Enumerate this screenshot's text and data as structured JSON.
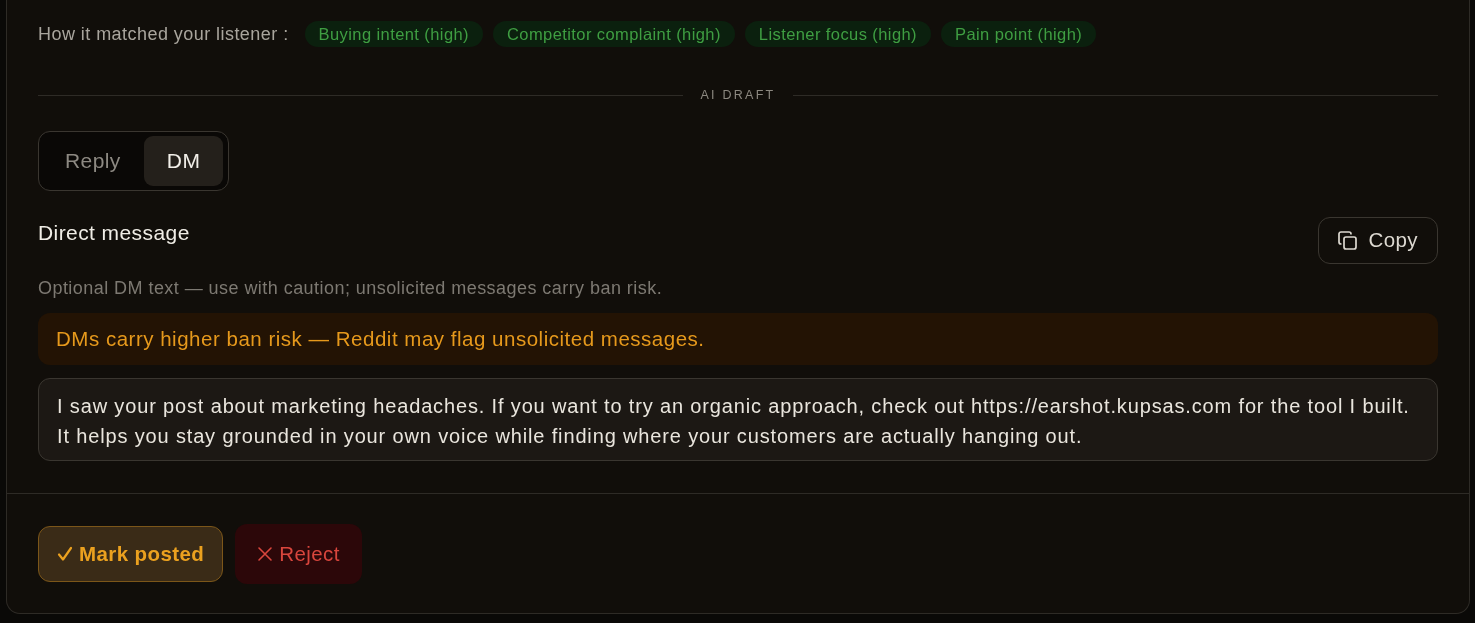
{
  "match": {
    "label": "How it matched your listener :",
    "tags": [
      "Buying intent (high)",
      "Competitor complaint (high)",
      "Listener focus (high)",
      "Pain point (high)"
    ]
  },
  "divider": {
    "label": "AI DRAFT"
  },
  "mode_tabs": [
    {
      "label": "Reply",
      "selected": false
    },
    {
      "label": "DM",
      "selected": true
    }
  ],
  "section": {
    "title": "Direct message",
    "copy_button": "Copy",
    "hint": "Optional DM text — use with caution; unsolicited messages carry ban risk.",
    "warning": "DMs carry higher ban risk — Reddit may flag unsolicited messages.",
    "message_field": {
      "value": "I saw your post about marketing headaches. If you want to try an organic approach, check out https://earshot.kupsas.com for the tool I built. It helps you stay grounded in your own voice while finding where your customers are actually hanging out."
    }
  },
  "actions": [
    {
      "kind": "confirm",
      "label": "Mark posted"
    },
    {
      "kind": "reject",
      "label": "Reject"
    }
  ]
}
